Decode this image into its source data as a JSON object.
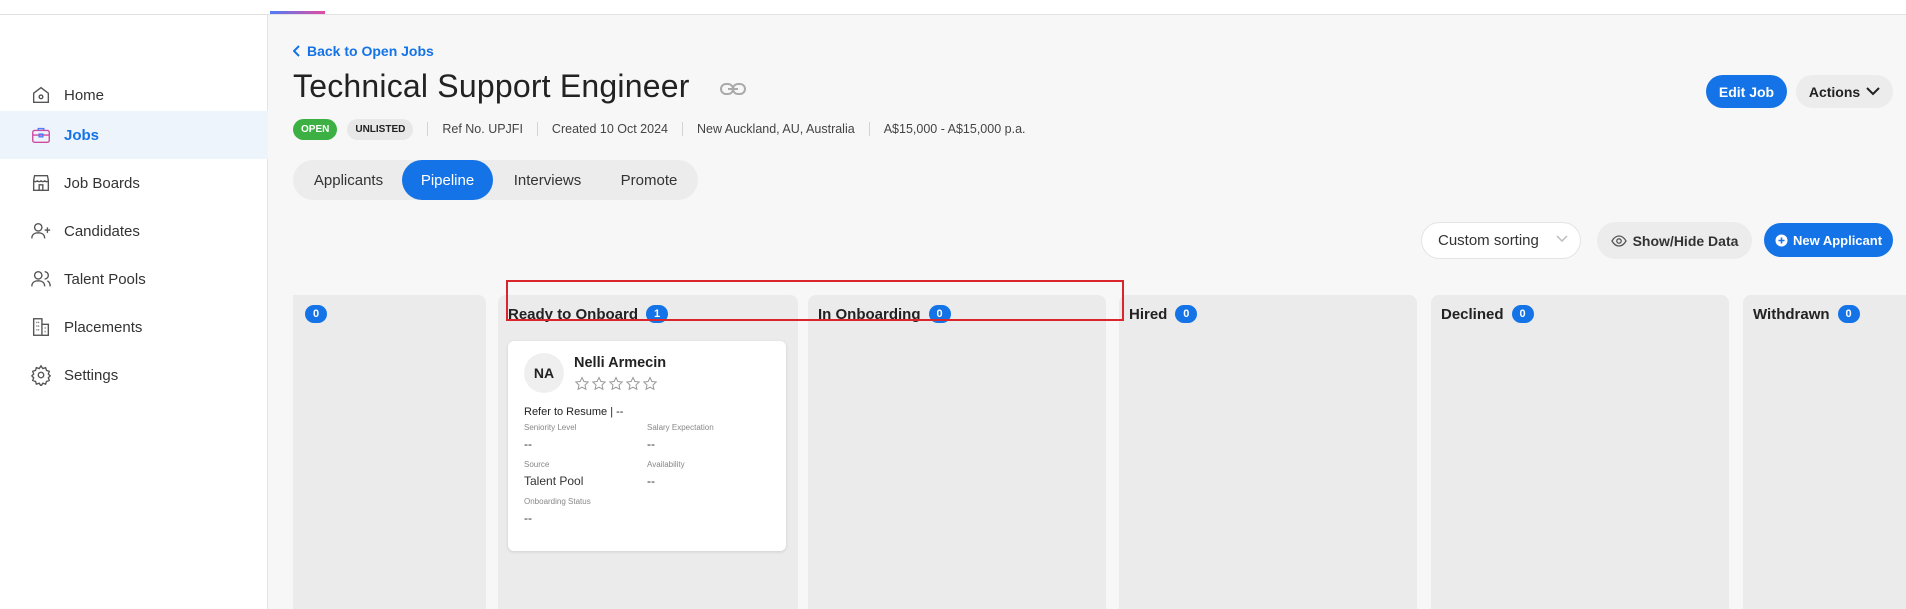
{
  "sidebar": {
    "items": [
      {
        "label": "Home",
        "icon": "home-icon"
      },
      {
        "label": "Jobs",
        "icon": "briefcase-icon"
      },
      {
        "label": "Job Boards",
        "icon": "storefront-icon"
      },
      {
        "label": "Candidates",
        "icon": "user-plus-icon"
      },
      {
        "label": "Talent Pools",
        "icon": "users-icon"
      },
      {
        "label": "Placements",
        "icon": "building-icon"
      },
      {
        "label": "Settings",
        "icon": "gear-icon"
      }
    ],
    "active": "Jobs"
  },
  "header": {
    "back_label": "Back to Open Jobs",
    "title": "Technical Support Engineer",
    "status_badge": "OPEN",
    "visibility_badge": "UNLISTED",
    "ref": "Ref No. UPJFI",
    "created": "Created 10 Oct 2024",
    "location": "New Auckland, AU, Australia",
    "salary": "A$15,000 - A$15,000 p.a.",
    "edit_label": "Edit Job",
    "actions_label": "Actions"
  },
  "tabs": [
    {
      "label": "Applicants"
    },
    {
      "label": "Pipeline"
    },
    {
      "label": "Interviews"
    },
    {
      "label": "Promote"
    }
  ],
  "active_tab": "Pipeline",
  "toolbar": {
    "sort_value": "Custom sorting",
    "showhide_label": "Show/Hide Data",
    "new_label": "New Applicant"
  },
  "pipeline": {
    "columns": [
      {
        "name": "",
        "count": "0"
      },
      {
        "name": "Ready to Onboard",
        "count": "1"
      },
      {
        "name": "In Onboarding",
        "count": "0"
      },
      {
        "name": "Hired",
        "count": "0"
      },
      {
        "name": "Declined",
        "count": "0"
      },
      {
        "name": "Withdrawn",
        "count": "0"
      }
    ]
  },
  "card": {
    "initials": "NA",
    "name": "Nelli Armecin",
    "refer": "Refer to Resume | --",
    "seniority_label": "Seniority Level",
    "seniority_value": "--",
    "salary_label": "Salary Expectation",
    "salary_value": "--",
    "source_label": "Source",
    "source_value": "Talent Pool",
    "availability_label": "Availability",
    "availability_value": "--",
    "onboarding_label": "Onboarding Status",
    "onboarding_value": "--",
    "rating": 0
  },
  "colors": {
    "primary": "#1473e6",
    "open_green": "#3cb043",
    "highlight_red": "#d9262c"
  }
}
